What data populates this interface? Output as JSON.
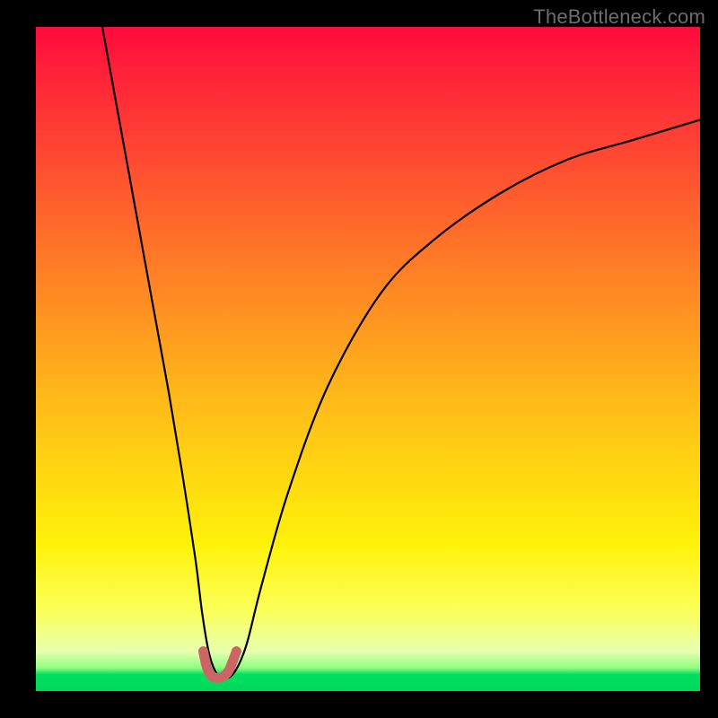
{
  "watermark": "TheBottleneck.com",
  "chart_data": {
    "type": "line",
    "title": "",
    "xlabel": "",
    "ylabel": "",
    "xlim": [
      0,
      100
    ],
    "ylim": [
      0,
      100
    ],
    "grid": false,
    "legend": false,
    "gradient_stops": [
      {
        "pos": 0,
        "color": "#ff0a3c"
      },
      {
        "pos": 18,
        "color": "#ff4432"
      },
      {
        "pos": 42,
        "color": "#ff8f22"
      },
      {
        "pos": 66,
        "color": "#ffd412"
      },
      {
        "pos": 88,
        "color": "#fbff5a"
      },
      {
        "pos": 96.5,
        "color": "#8fff80"
      },
      {
        "pos": 100,
        "color": "#00d85a"
      }
    ],
    "series": [
      {
        "name": "bottleneck-curve",
        "stroke": "#000000",
        "x": [
          10,
          12,
          14,
          16,
          18,
          20,
          22,
          24,
          25,
          26,
          27,
          28,
          29,
          30,
          31,
          32,
          34,
          38,
          44,
          52,
          60,
          70,
          80,
          90,
          100
        ],
        "y": [
          100,
          89,
          78,
          67,
          56,
          45,
          33,
          20,
          12,
          6,
          3,
          2,
          2,
          3,
          5,
          8,
          16,
          30,
          46,
          60,
          68,
          75,
          80,
          83,
          86
        ]
      },
      {
        "name": "sweet-spot-marker",
        "stroke": "#cc6666",
        "x": [
          25.2,
          25.8,
          26.6,
          27.4,
          28.2,
          29.0,
          29.6,
          30.2
        ],
        "y": [
          6.0,
          3.4,
          2.2,
          2.0,
          2.2,
          3.0,
          4.4,
          6.0
        ]
      }
    ]
  }
}
